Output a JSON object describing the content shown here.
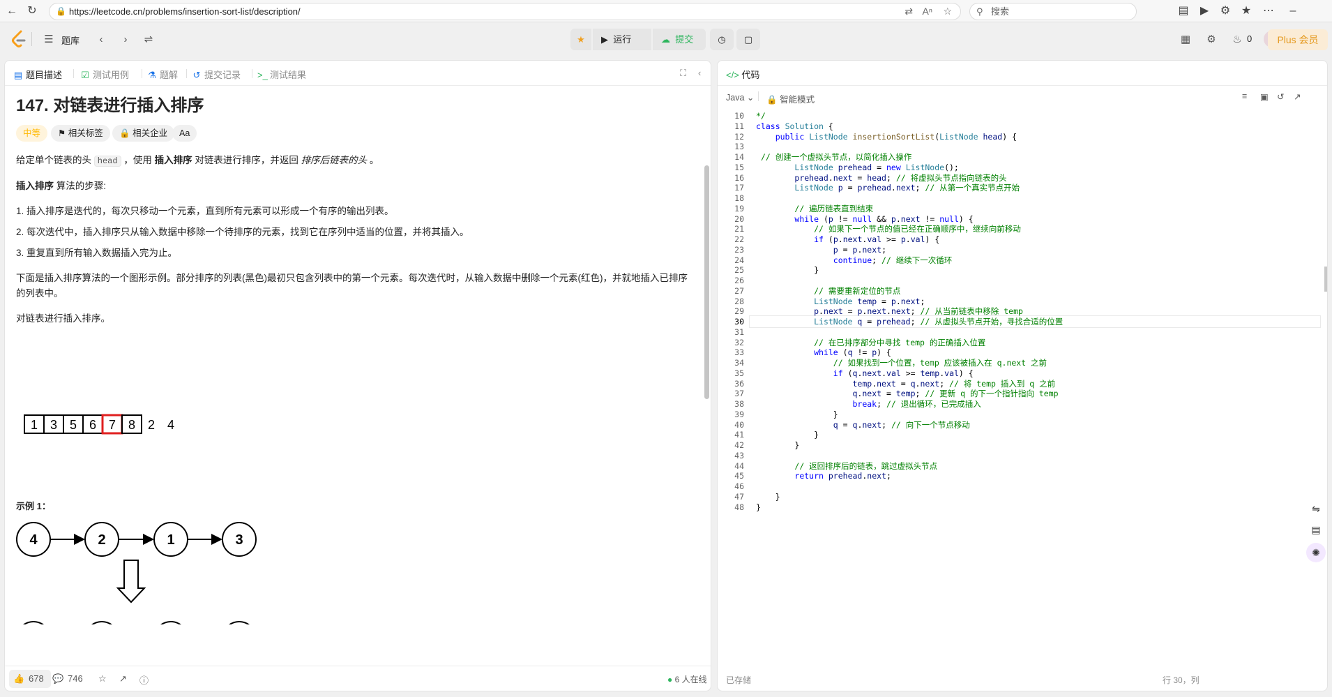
{
  "browser": {
    "url": "https://leetcode.cn/problems/insertion-sort-list/description/",
    "search_placeholder": "搜索"
  },
  "nav": {
    "problem_list": "题库",
    "run": "运行",
    "submit": "提交",
    "plus": "Plus 会员",
    "streak": "0"
  },
  "left_tabs": [
    "题目描述",
    "测试用例",
    "题解",
    "提交记录",
    "测试结果"
  ],
  "problem": {
    "title": "147. 对链表进行插入排序",
    "difficulty": "中等",
    "tag_topics": "相关标签",
    "tag_companies": "相关企业",
    "tag_font": "Aa",
    "p1_a": "给定单个链表的头 ",
    "p1_code": "head",
    "p1_b": " ，使用 ",
    "p1_bold": "插入排序",
    "p1_c": " 对链表进行排序，并返回 ",
    "p1_italic": "排序后链表的头",
    "p1_d": " 。",
    "p2_bold": "插入排序",
    "p2_rest": " 算法的步骤:",
    "step1": "1. 插入排序是迭代的，每次只移动一个元素，直到所有元素可以形成一个有序的输出列表。",
    "step2": "2. 每次迭代中，插入排序只从输入数据中移除一个待排序的元素，找到它在序列中适当的位置，并将其插入。",
    "step3": "3. 重复直到所有输入数据插入完为止。",
    "p3": "下面是插入排序算法的一个图形示例。部分排序的列表(黑色)最初只包含列表中的第一个元素。每次迭代时，从输入数据中删除一个元素(红色)，并就地插入已排序的列表中。",
    "p4": "对链表进行插入排序。",
    "anim_boxes": [
      "1",
      "3",
      "5",
      "6",
      "7",
      "8"
    ],
    "anim_rest": [
      "2",
      "4"
    ],
    "example_label": "示例 1：",
    "example_nodes": [
      "4",
      "2",
      "1",
      "3"
    ]
  },
  "left_footer": {
    "likes": "678",
    "comments": "746",
    "online": "6 人在线"
  },
  "right": {
    "tab": "代码",
    "lang": "Java",
    "mode": "智能模式",
    "saved": "已存储",
    "position": "行 30，列"
  },
  "code_lines": [
    {
      "n": "10",
      "t": "*/"
    },
    {
      "n": "11",
      "t": "class Solution {"
    },
    {
      "n": "12",
      "t": "    public ListNode insertionSortList(ListNode head) {"
    },
    {
      "n": "13",
      "t": ""
    },
    {
      "n": "14",
      "t": " // 创建一个虚拟头节点，以简化插入操作"
    },
    {
      "n": "15",
      "t": "        ListNode prehead = new ListNode();"
    },
    {
      "n": "16",
      "t": "        prehead.next = head; // 将虚拟头节点指向链表的头"
    },
    {
      "n": "17",
      "t": "        ListNode p = prehead.next; // 从第一个真实节点开始"
    },
    {
      "n": "18",
      "t": ""
    },
    {
      "n": "19",
      "t": "        // 遍历链表直到结束"
    },
    {
      "n": "20",
      "t": "        while (p != null && p.next != null) {"
    },
    {
      "n": "21",
      "t": "            // 如果下一个节点的值已经在正确顺序中，继续向前移动"
    },
    {
      "n": "22",
      "t": "            if (p.next.val >= p.val) {"
    },
    {
      "n": "23",
      "t": "                p = p.next;"
    },
    {
      "n": "24",
      "t": "                continue; // 继续下一次循环"
    },
    {
      "n": "25",
      "t": "            }"
    },
    {
      "n": "26",
      "t": ""
    },
    {
      "n": "27",
      "t": "            // 需要重新定位的节点"
    },
    {
      "n": "28",
      "t": "            ListNode temp = p.next;"
    },
    {
      "n": "29",
      "t": "            p.next = p.next.next; // 从当前链表中移除 temp"
    },
    {
      "n": "30",
      "t": "            ListNode q = prehead; // 从虚拟头节点开始，寻找合适的位置"
    },
    {
      "n": "31",
      "t": ""
    },
    {
      "n": "32",
      "t": "            // 在已排序部分中寻找 temp 的正确插入位置"
    },
    {
      "n": "33",
      "t": "            while (q != p) {"
    },
    {
      "n": "34",
      "t": "                // 如果找到一个位置，temp 应该被插入在 q.next 之前"
    },
    {
      "n": "35",
      "t": "                if (q.next.val >= temp.val) {"
    },
    {
      "n": "36",
      "t": "                    temp.next = q.next; // 将 temp 插入到 q 之前"
    },
    {
      "n": "37",
      "t": "                    q.next = temp; // 更新 q 的下一个指针指向 temp"
    },
    {
      "n": "38",
      "t": "                    break; // 退出循环，已完成插入"
    },
    {
      "n": "39",
      "t": "                }"
    },
    {
      "n": "40",
      "t": "                q = q.next; // 向下一个节点移动"
    },
    {
      "n": "41",
      "t": "            }"
    },
    {
      "n": "42",
      "t": "        }"
    },
    {
      "n": "43",
      "t": ""
    },
    {
      "n": "44",
      "t": "        // 返回排序后的链表，跳过虚拟头节点"
    },
    {
      "n": "45",
      "t": "        return prehead.next;"
    },
    {
      "n": "46",
      "t": ""
    },
    {
      "n": "47",
      "t": "    }"
    },
    {
      "n": "48",
      "t": "}"
    }
  ]
}
